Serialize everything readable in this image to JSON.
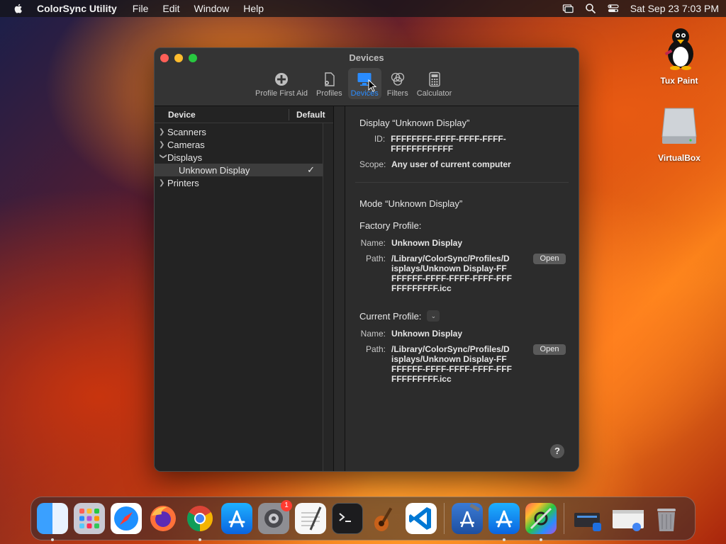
{
  "menubar": {
    "app_name": "ColorSync Utility",
    "menus": [
      "File",
      "Edit",
      "Window",
      "Help"
    ],
    "clock": "Sat Sep 23  7:03 PM"
  },
  "desktop": {
    "icons": [
      {
        "label": "Tux Paint"
      },
      {
        "label": "VirtualBox"
      }
    ]
  },
  "window": {
    "title": "Devices",
    "toolbar": [
      {
        "label": "Profile First Aid",
        "icon": "plus-circle-icon",
        "active": false
      },
      {
        "label": "Profiles",
        "icon": "document-gear-icon",
        "active": false
      },
      {
        "label": "Devices",
        "icon": "display-icon",
        "active": true
      },
      {
        "label": "Filters",
        "icon": "filter-circles-icon",
        "active": false
      },
      {
        "label": "Calculator",
        "icon": "calculator-icon",
        "active": false
      }
    ],
    "sidebar": {
      "col_device": "Device",
      "col_default": "Default",
      "items": [
        {
          "label": "Scanners",
          "expanded": false
        },
        {
          "label": "Cameras",
          "expanded": false
        },
        {
          "label": "Displays",
          "expanded": true
        },
        {
          "label": "Unknown Display",
          "checkmark": "✓"
        },
        {
          "label": "Printers",
          "expanded": false
        }
      ]
    },
    "detail": {
      "display_heading": "Display “Unknown Display”",
      "id_label": "ID:",
      "id_value": "FFFFFFFF-FFFF-FFFF-FFFF-FFFFFFFFFFFF",
      "scope_label": "Scope:",
      "scope_value": "Any user of current computer",
      "mode_heading": "Mode “Unknown Display”",
      "factory_heading": "Factory Profile:",
      "factory_name_label": "Name:",
      "factory_name_value": "Unknown Display",
      "factory_path_label": "Path:",
      "factory_path_value": "/Library/ColorSync/Profiles/Displays/Unknown Display-FFFFFFFF-FFFF-FFFF-FFFF-FFFFFFFFFFFF.icc",
      "open_label": "Open",
      "current_heading": "Current Profile:",
      "current_name_label": "Name:",
      "current_name_value": "Unknown Display",
      "current_path_label": "Path:",
      "current_path_value": "/Library/ColorSync/Profiles/Displays/Unknown Display-FFFFFFFF-FFFF-FFFF-FFFF-FFFFFFFFFFFF.icc",
      "help_label": "?"
    }
  },
  "dock": {
    "settings_badge": "1"
  },
  "colors": {
    "accent": "#2a8cff",
    "window_bg": "#2a2a2a"
  }
}
